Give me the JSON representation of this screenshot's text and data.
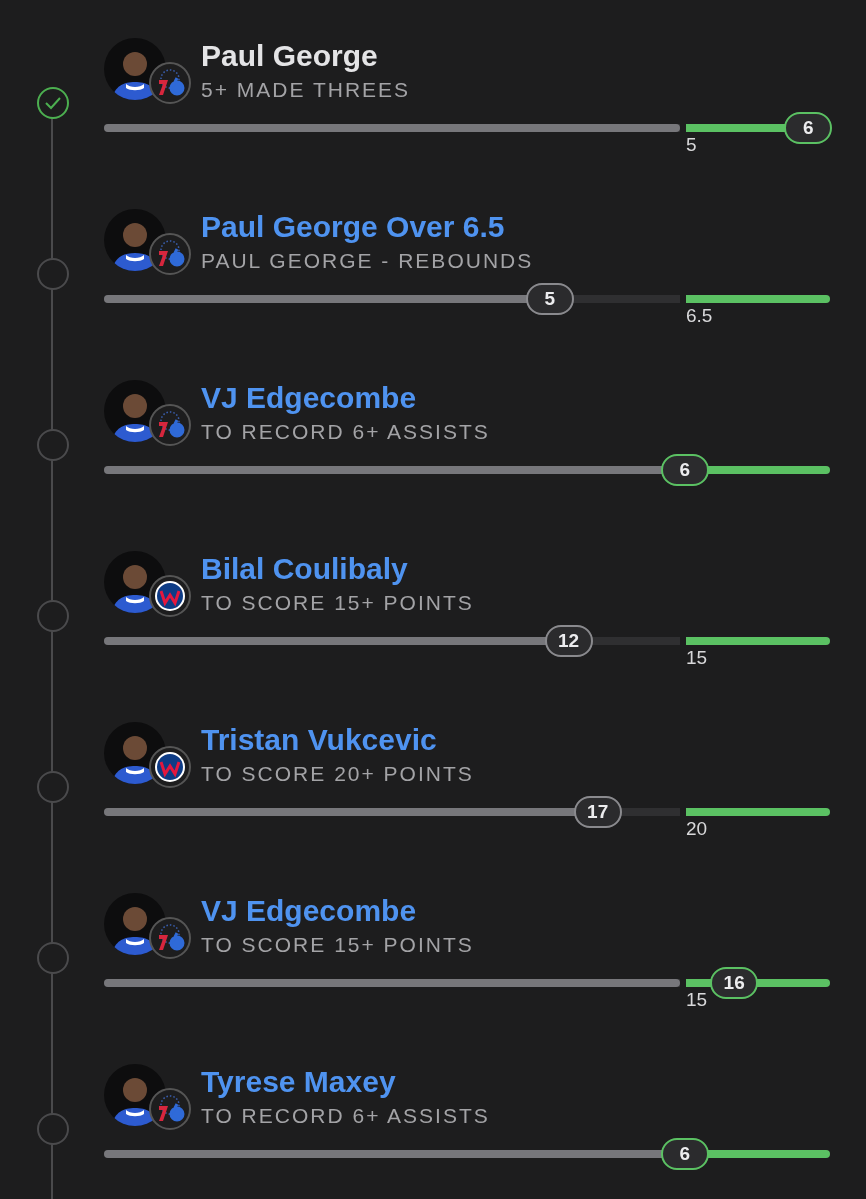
{
  "props": [
    {
      "title": "Paul George",
      "subtitle": "5+ MADE THREES",
      "kind": "sixers",
      "settled": true,
      "reached": true,
      "level": 0.97,
      "current": "6",
      "target": "5"
    },
    {
      "title": "Paul George Over 6.5",
      "subtitle": "PAUL GEORGE - REBOUNDS",
      "kind": "sixers",
      "settled": false,
      "reached": false,
      "level": 0.614,
      "current": "5",
      "target": "6.5"
    },
    {
      "title": "VJ Edgecombe",
      "subtitle": "TO RECORD 6+ ASSISTS",
      "kind": "sixers",
      "settled": false,
      "reached": true,
      "level": 0.8,
      "current": "6"
    },
    {
      "title": "Bilal Coulibaly",
      "subtitle": "TO SCORE 15+ POINTS",
      "kind": "wizards",
      "settled": false,
      "reached": false,
      "level": 0.64,
      "current": "12",
      "target": "15"
    },
    {
      "title": "Tristan Vukcevic",
      "subtitle": "TO SCORE 20+ POINTS",
      "kind": "wizards",
      "settled": false,
      "reached": false,
      "level": 0.68,
      "current": "17",
      "target": "20"
    },
    {
      "title": "VJ Edgecombe",
      "subtitle": "TO SCORE 15+ POINTS",
      "kind": "sixers",
      "settled": false,
      "reached": true,
      "level": 0.868,
      "current": "16",
      "target": "15"
    },
    {
      "title": "Tyrese Maxey",
      "subtitle": "TO RECORD 6+ ASSISTS",
      "kind": "sixers",
      "settled": false,
      "reached": true,
      "level": 0.8,
      "current": "6"
    }
  ]
}
